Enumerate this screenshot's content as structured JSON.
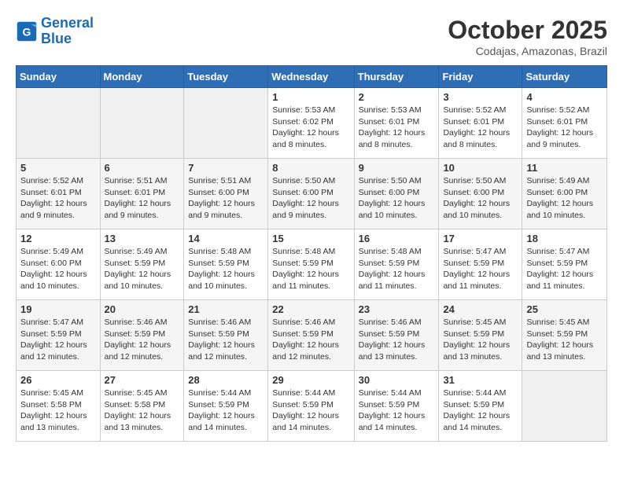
{
  "header": {
    "logo_line1": "General",
    "logo_line2": "Blue",
    "month": "October 2025",
    "location": "Codajas, Amazonas, Brazil"
  },
  "weekdays": [
    "Sunday",
    "Monday",
    "Tuesday",
    "Wednesday",
    "Thursday",
    "Friday",
    "Saturday"
  ],
  "weeks": [
    [
      {
        "day": "",
        "info": ""
      },
      {
        "day": "",
        "info": ""
      },
      {
        "day": "",
        "info": ""
      },
      {
        "day": "1",
        "info": "Sunrise: 5:53 AM\nSunset: 6:02 PM\nDaylight: 12 hours and 8 minutes."
      },
      {
        "day": "2",
        "info": "Sunrise: 5:53 AM\nSunset: 6:01 PM\nDaylight: 12 hours and 8 minutes."
      },
      {
        "day": "3",
        "info": "Sunrise: 5:52 AM\nSunset: 6:01 PM\nDaylight: 12 hours and 8 minutes."
      },
      {
        "day": "4",
        "info": "Sunrise: 5:52 AM\nSunset: 6:01 PM\nDaylight: 12 hours and 9 minutes."
      }
    ],
    [
      {
        "day": "5",
        "info": "Sunrise: 5:52 AM\nSunset: 6:01 PM\nDaylight: 12 hours and 9 minutes."
      },
      {
        "day": "6",
        "info": "Sunrise: 5:51 AM\nSunset: 6:01 PM\nDaylight: 12 hours and 9 minutes."
      },
      {
        "day": "7",
        "info": "Sunrise: 5:51 AM\nSunset: 6:00 PM\nDaylight: 12 hours and 9 minutes."
      },
      {
        "day": "8",
        "info": "Sunrise: 5:50 AM\nSunset: 6:00 PM\nDaylight: 12 hours and 9 minutes."
      },
      {
        "day": "9",
        "info": "Sunrise: 5:50 AM\nSunset: 6:00 PM\nDaylight: 12 hours and 10 minutes."
      },
      {
        "day": "10",
        "info": "Sunrise: 5:50 AM\nSunset: 6:00 PM\nDaylight: 12 hours and 10 minutes."
      },
      {
        "day": "11",
        "info": "Sunrise: 5:49 AM\nSunset: 6:00 PM\nDaylight: 12 hours and 10 minutes."
      }
    ],
    [
      {
        "day": "12",
        "info": "Sunrise: 5:49 AM\nSunset: 6:00 PM\nDaylight: 12 hours and 10 minutes."
      },
      {
        "day": "13",
        "info": "Sunrise: 5:49 AM\nSunset: 5:59 PM\nDaylight: 12 hours and 10 minutes."
      },
      {
        "day": "14",
        "info": "Sunrise: 5:48 AM\nSunset: 5:59 PM\nDaylight: 12 hours and 10 minutes."
      },
      {
        "day": "15",
        "info": "Sunrise: 5:48 AM\nSunset: 5:59 PM\nDaylight: 12 hours and 11 minutes."
      },
      {
        "day": "16",
        "info": "Sunrise: 5:48 AM\nSunset: 5:59 PM\nDaylight: 12 hours and 11 minutes."
      },
      {
        "day": "17",
        "info": "Sunrise: 5:47 AM\nSunset: 5:59 PM\nDaylight: 12 hours and 11 minutes."
      },
      {
        "day": "18",
        "info": "Sunrise: 5:47 AM\nSunset: 5:59 PM\nDaylight: 12 hours and 11 minutes."
      }
    ],
    [
      {
        "day": "19",
        "info": "Sunrise: 5:47 AM\nSunset: 5:59 PM\nDaylight: 12 hours and 12 minutes."
      },
      {
        "day": "20",
        "info": "Sunrise: 5:46 AM\nSunset: 5:59 PM\nDaylight: 12 hours and 12 minutes."
      },
      {
        "day": "21",
        "info": "Sunrise: 5:46 AM\nSunset: 5:59 PM\nDaylight: 12 hours and 12 minutes."
      },
      {
        "day": "22",
        "info": "Sunrise: 5:46 AM\nSunset: 5:59 PM\nDaylight: 12 hours and 12 minutes."
      },
      {
        "day": "23",
        "info": "Sunrise: 5:46 AM\nSunset: 5:59 PM\nDaylight: 12 hours and 13 minutes."
      },
      {
        "day": "24",
        "info": "Sunrise: 5:45 AM\nSunset: 5:59 PM\nDaylight: 12 hours and 13 minutes."
      },
      {
        "day": "25",
        "info": "Sunrise: 5:45 AM\nSunset: 5:59 PM\nDaylight: 12 hours and 13 minutes."
      }
    ],
    [
      {
        "day": "26",
        "info": "Sunrise: 5:45 AM\nSunset: 5:58 PM\nDaylight: 12 hours and 13 minutes."
      },
      {
        "day": "27",
        "info": "Sunrise: 5:45 AM\nSunset: 5:58 PM\nDaylight: 12 hours and 13 minutes."
      },
      {
        "day": "28",
        "info": "Sunrise: 5:44 AM\nSunset: 5:59 PM\nDaylight: 12 hours and 14 minutes."
      },
      {
        "day": "29",
        "info": "Sunrise: 5:44 AM\nSunset: 5:59 PM\nDaylight: 12 hours and 14 minutes."
      },
      {
        "day": "30",
        "info": "Sunrise: 5:44 AM\nSunset: 5:59 PM\nDaylight: 12 hours and 14 minutes."
      },
      {
        "day": "31",
        "info": "Sunrise: 5:44 AM\nSunset: 5:59 PM\nDaylight: 12 hours and 14 minutes."
      },
      {
        "day": "",
        "info": ""
      }
    ]
  ]
}
